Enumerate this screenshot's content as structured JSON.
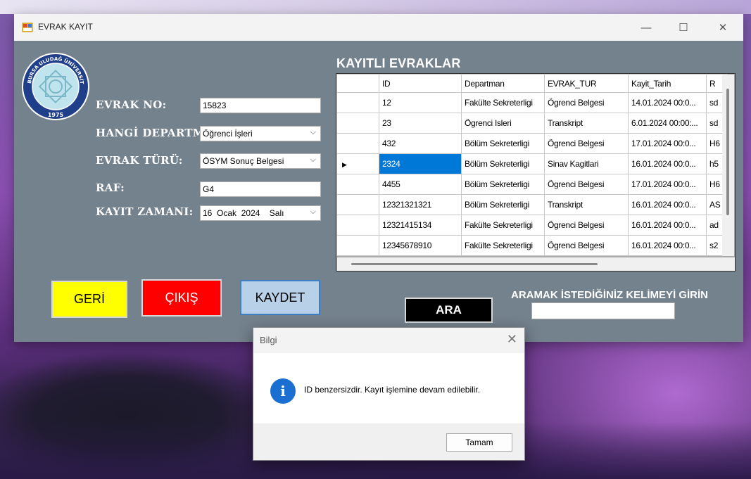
{
  "window": {
    "title": "EVRAK KAYIT",
    "controls": [
      "—",
      "☐",
      "✕"
    ]
  },
  "logo": {
    "text": "BURSA ULUDAĞ ÜNİVERSİTESİ",
    "year": "1975"
  },
  "form": {
    "evrak_no_label": "EVRAK NO:",
    "evrak_no_value": "15823",
    "departman_label": "HANGİ DEPARTMAN",
    "departman_value": "Öğrenci İşleri",
    "evrak_turu_label": "EVRAK TÜRÜ:",
    "evrak_turu_value": "ÖSYM Sonuç Belgesi",
    "raf_label": "RAF:",
    "raf_value": "G4",
    "kayit_zamani_label": "KAYIT ZAMANI:",
    "kayit_zamani_day": "16",
    "kayit_zamani_month": "Ocak",
    "kayit_zamani_year": "2024",
    "kayit_zamani_weekday": "Salı"
  },
  "buttons": {
    "geri": "GERİ",
    "cikis": "ÇIKIŞ",
    "kaydet": "KAYDET",
    "ara": "ARA"
  },
  "grid": {
    "title": "KAYITLI EVRAKLAR",
    "columns": [
      "ID",
      "Departman",
      "EVRAK_TUR",
      "Kayit_Tarih",
      "R"
    ],
    "rows": [
      [
        "12",
        "Fakülte Sekreterligi",
        "Ögrenci Belgesi",
        "14.01.2024 00:0...",
        "sd"
      ],
      [
        "23",
        "Ögrenci Isleri",
        "Transkript",
        "6.01.2024 00:00:...",
        "sd"
      ],
      [
        "432",
        "Bölüm Sekreterligi",
        "Ögrenci Belgesi",
        "17.01.2024 00:0...",
        "H6"
      ],
      [
        "2324",
        "Bölüm Sekreterligi",
        "Sinav Kagitlari",
        "16.01.2024 00:0...",
        "h5"
      ],
      [
        "4455",
        "Bölüm Sekreterligi",
        "Ögrenci Belgesi",
        "17.01.2024 00:0...",
        "H6"
      ],
      [
        "12321321321",
        "Bölüm Sekreterligi",
        "Transkript",
        "16.01.2024 00:0...",
        "AS"
      ],
      [
        "12321415134",
        "Fakülte Sekreterligi",
        "Ögrenci Belgesi",
        "16.01.2024 00:0...",
        "ad"
      ],
      [
        "12345678910",
        "Fakülte Sekreterligi",
        "Ögrenci Belgesi",
        "16.01.2024 00:0...",
        "s2"
      ]
    ],
    "selected_row": 3,
    "current_row_marker": "▶"
  },
  "search": {
    "label": "ARAMAK İSTEDİĞİNİZ KELİMEYİ GİRİN",
    "value": ""
  },
  "dialog": {
    "title": "Bilgi",
    "close": "✕",
    "icon": "info-icon",
    "icon_glyph": "i",
    "message": "ID benzersizdir. Kayıt işlemine devam edilebilir.",
    "ok": "Tamam"
  },
  "colors": {
    "window_bg": "#74828e",
    "geri": "#ffff00",
    "cikis": "#ff0000",
    "kaydet": "#b8d0e8",
    "ara": "#000000",
    "selection": "#0078d7"
  }
}
